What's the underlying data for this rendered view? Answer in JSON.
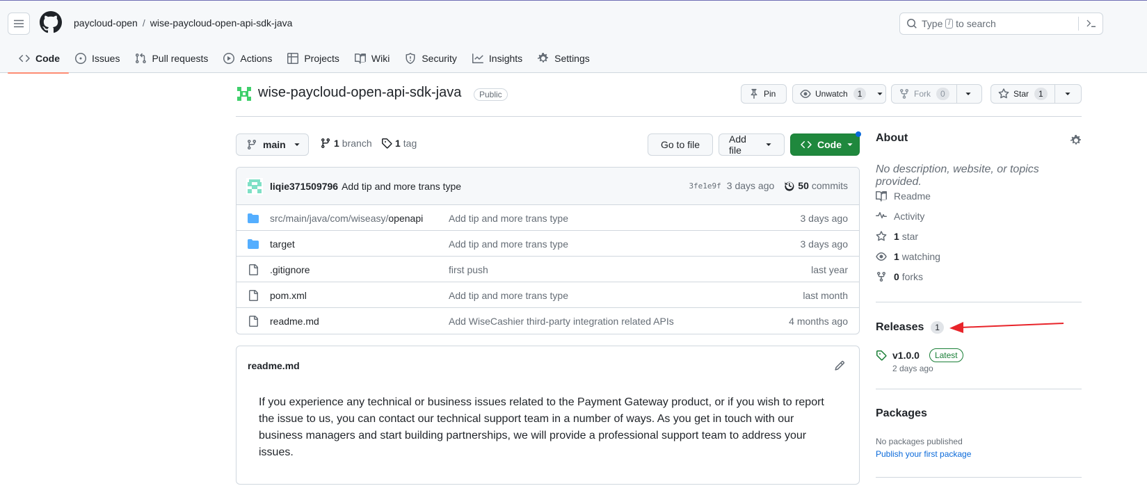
{
  "header": {
    "owner": "paycloud-open",
    "separator": "/",
    "repo": "wise-paycloud-open-api-sdk-java",
    "search_prefix": "Type",
    "search_key": "/",
    "search_suffix": "to search"
  },
  "tabs": [
    {
      "label": "Code",
      "icon": "code-icon"
    },
    {
      "label": "Issues",
      "icon": "issue-icon"
    },
    {
      "label": "Pull requests",
      "icon": "pull-request-icon"
    },
    {
      "label": "Actions",
      "icon": "play-icon"
    },
    {
      "label": "Projects",
      "icon": "table-icon"
    },
    {
      "label": "Wiki",
      "icon": "book-icon"
    },
    {
      "label": "Security",
      "icon": "shield-icon"
    },
    {
      "label": "Insights",
      "icon": "graph-icon"
    },
    {
      "label": "Settings",
      "icon": "gear-icon"
    }
  ],
  "repo_header": {
    "name": "wise-paycloud-open-api-sdk-java",
    "visibility": "Public",
    "pin": "Pin",
    "unwatch": "Unwatch",
    "watch_count": "1",
    "fork": "Fork",
    "fork_count": "0",
    "star": "Star",
    "star_count": "1"
  },
  "toolbar": {
    "branch": "main",
    "branch_count": "1",
    "branch_label": "branch",
    "tag_count": "1",
    "tag_label": "tag",
    "go_to_file": "Go to file",
    "add_file": "Add file",
    "code": "Code"
  },
  "commit": {
    "author": "liqie371509796",
    "message": "Add tip and more trans type",
    "sha": "3fe1e9f",
    "age": "3 days ago",
    "count": "50",
    "count_label": "commits"
  },
  "files": [
    {
      "type": "folder",
      "name_dim": "src/main/java/com/wiseasy/",
      "name": "openapi",
      "message": "Add tip and more trans type",
      "age": "3 days ago"
    },
    {
      "type": "folder",
      "name_dim": "",
      "name": "target",
      "message": "Add tip and more trans type",
      "age": "3 days ago"
    },
    {
      "type": "file",
      "name_dim": "",
      "name": ".gitignore",
      "message": "first push",
      "age": "last year"
    },
    {
      "type": "file",
      "name_dim": "",
      "name": "pom.xml",
      "message": "Add tip and more trans type",
      "age": "last month"
    },
    {
      "type": "file",
      "name_dim": "",
      "name": "readme.md",
      "message": "Add WiseCashier third-party integration related APIs",
      "age": "4 months ago"
    }
  ],
  "readme": {
    "title": "readme.md",
    "body": "If you experience any technical or business issues related to the Payment Gateway product, or if you wish to report the issue to us, you can contact our technical support team in a number of ways. As you get in touch with our business managers and start building partnerships, we will provide a professional support team to address your issues."
  },
  "about": {
    "title": "About",
    "description": "No description, website, or topics provided.",
    "readme": "Readme",
    "activity": "Activity",
    "stars_count": "1",
    "stars_label": "star",
    "watching_count": "1",
    "watching_label": "watching",
    "forks_count": "0",
    "forks_label": "forks"
  },
  "releases": {
    "title": "Releases",
    "count": "1",
    "version": "v1.0.0",
    "latest": "Latest",
    "date": "2 days ago"
  },
  "packages": {
    "title": "Packages",
    "none": "No packages published",
    "link": "Publish your first package"
  },
  "colors": {
    "accent_tab": "#fd8c73",
    "code_button": "#1f883d",
    "link": "#0969da",
    "annotation_arrow": "#e8242a",
    "folder": "#54aeff"
  }
}
